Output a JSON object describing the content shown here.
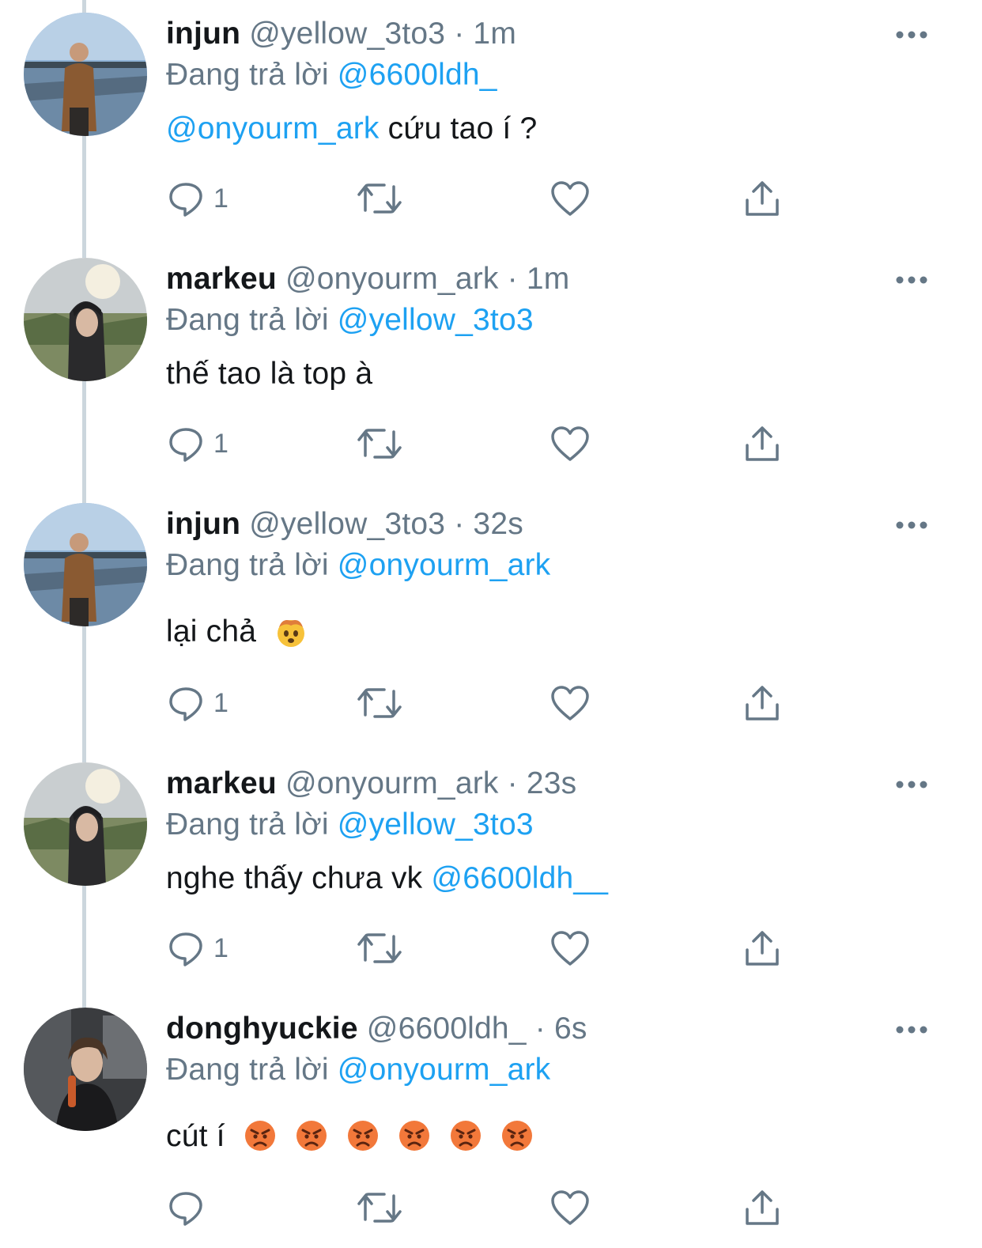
{
  "replying_prefix": "Đang trả lời",
  "tweets": [
    {
      "name": "injun",
      "handle": "@yellow_3to3",
      "time": "· 1m",
      "replying_to": "@6600ldh_",
      "text_mention": "@onyourm_ark",
      "text": " cứu tao í ?",
      "reply_count": "1",
      "avatar": "injun-avatar"
    },
    {
      "name": "markeu",
      "handle": "@onyourm_ark",
      "time": "· 1m",
      "replying_to": "@yellow_3to3",
      "text": "thế tao là top à",
      "reply_count": "1",
      "avatar": "markeu-avatar"
    },
    {
      "name": "injun",
      "handle": "@yellow_3to3",
      "time": "· 32s",
      "replying_to": "@onyourm_ark",
      "text": "lại chả",
      "emoji": "exploding-head-emoji",
      "reply_count": "1",
      "avatar": "injun-avatar"
    },
    {
      "name": "markeu",
      "handle": "@onyourm_ark",
      "time": "· 23s",
      "replying_to": "@yellow_3to3",
      "text": "nghe thấy chưa vk ",
      "text_mention": "@6600ldh__",
      "reply_count": "1",
      "avatar": "markeu-avatar"
    },
    {
      "name": "donghyuckie",
      "handle": "@6600ldh_",
      "time": "· 6s",
      "replying_to": "@onyourm_ark",
      "text": "cút í",
      "emoji": "angry-face-emoji",
      "emoji_count": 6,
      "reply_count": "",
      "avatar": "donghyuckie-avatar"
    }
  ],
  "icons": [
    "reply-icon",
    "retweet-icon",
    "like-icon",
    "share-icon",
    "more-icon"
  ],
  "colors": {
    "link": "#1da1f2",
    "muted": "#657786",
    "text": "#14171a",
    "thread_line": "#ccd6dd"
  }
}
